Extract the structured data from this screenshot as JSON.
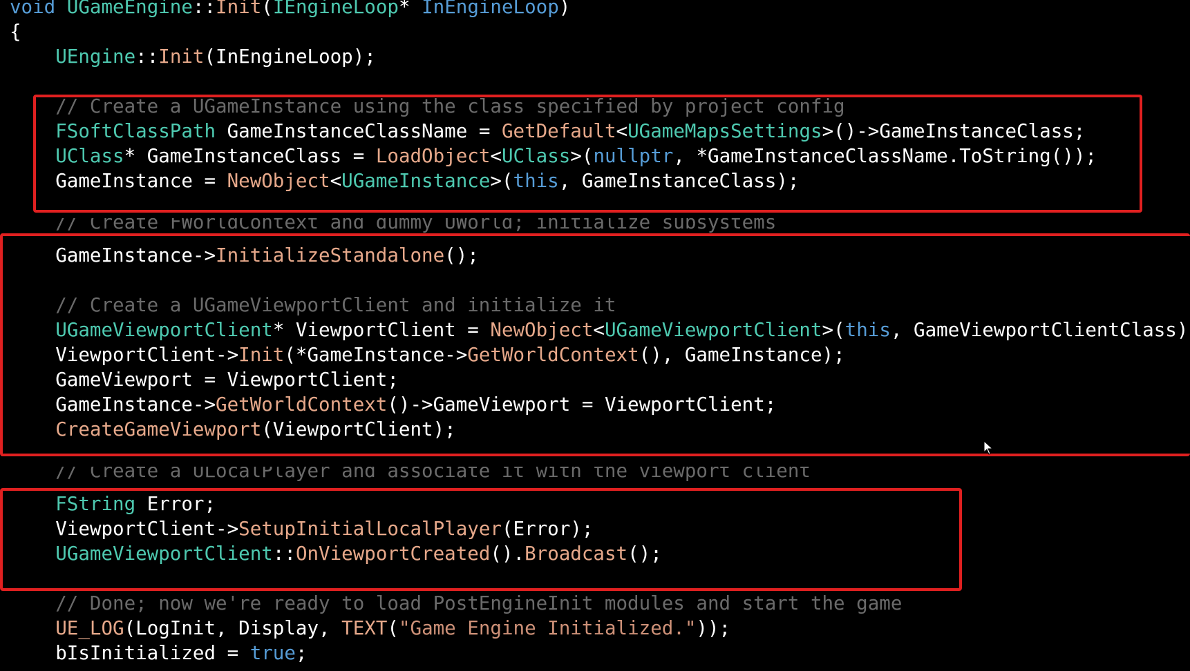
{
  "theme": {
    "background": "#000000",
    "highlight_border": "#e02020",
    "token_colors": {
      "keyword": "#569cd6",
      "type": "#4ec9b0",
      "func": "#e6a88a",
      "comment": "#6a6a6a",
      "string": "#ce9178",
      "plain": "#ffffff"
    }
  },
  "code": {
    "lines": [
      [
        [
          "keyword",
          "void "
        ],
        [
          "type",
          "UGameEngine"
        ],
        [
          "plain",
          "::"
        ],
        [
          "func",
          "Init"
        ],
        [
          "plain",
          "("
        ],
        [
          "type",
          "IEngineLoop"
        ],
        [
          "plain",
          "* "
        ],
        [
          "keyword",
          "InEngineLoop"
        ],
        [
          "plain",
          ")"
        ]
      ],
      [
        [
          "plain",
          "{"
        ]
      ],
      [
        [
          "plain",
          "    "
        ],
        [
          "type",
          "UEngine"
        ],
        [
          "plain",
          "::"
        ],
        [
          "func",
          "Init"
        ],
        [
          "plain",
          "(InEngineLoop);"
        ]
      ],
      [],
      [
        [
          "comment",
          "    // Create a UGameInstance using the class specified by project config"
        ]
      ],
      [
        [
          "plain",
          "    "
        ],
        [
          "type",
          "FSoftClassPath"
        ],
        [
          "plain",
          " GameInstanceClassName = "
        ],
        [
          "func",
          "GetDefault"
        ],
        [
          "plain",
          "<"
        ],
        [
          "type",
          "UGameMapsSettings"
        ],
        [
          "plain",
          ">()->GameInstanceClass;"
        ]
      ],
      [
        [
          "plain",
          "    "
        ],
        [
          "type",
          "UClass"
        ],
        [
          "plain",
          "* GameInstanceClass = "
        ],
        [
          "func",
          "LoadObject"
        ],
        [
          "plain",
          "<"
        ],
        [
          "type",
          "UClass"
        ],
        [
          "plain",
          ">("
        ],
        [
          "keyword",
          "nullptr"
        ],
        [
          "plain",
          ", *GameInstanceClassName.ToString());"
        ]
      ],
      [
        [
          "plain",
          "    GameInstance = "
        ],
        [
          "func",
          "NewObject"
        ],
        [
          "plain",
          "<"
        ],
        [
          "type",
          "UGameInstance"
        ],
        [
          "plain",
          ">("
        ],
        [
          "keyword",
          "this"
        ],
        [
          "plain",
          ", GameInstanceClass);"
        ]
      ],
      [],
      [
        [
          "comment",
          "    // Create FWorldContext and dummy UWorld; initialize subsystems"
        ]
      ],
      [
        [
          "plain",
          "    GameInstance->"
        ],
        [
          "func",
          "InitializeStandalone"
        ],
        [
          "plain",
          "();"
        ]
      ],
      [],
      [
        [
          "comment",
          "    // Create a UGameViewportClient and initialize it"
        ]
      ],
      [
        [
          "plain",
          "    "
        ],
        [
          "type",
          "UGameViewportClient"
        ],
        [
          "plain",
          "* ViewportClient = "
        ],
        [
          "func",
          "NewObject"
        ],
        [
          "plain",
          "<"
        ],
        [
          "type",
          "UGameViewportClient"
        ],
        [
          "plain",
          ">("
        ],
        [
          "keyword",
          "this"
        ],
        [
          "plain",
          ", GameViewportClientClass);"
        ]
      ],
      [
        [
          "plain",
          "    ViewportClient->"
        ],
        [
          "func",
          "Init"
        ],
        [
          "plain",
          "(*GameInstance->"
        ],
        [
          "func",
          "GetWorldContext"
        ],
        [
          "plain",
          "(), GameInstance);"
        ]
      ],
      [
        [
          "plain",
          "    GameViewport = ViewportClient;"
        ]
      ],
      [
        [
          "plain",
          "    GameInstance->"
        ],
        [
          "func",
          "GetWorldContext"
        ],
        [
          "plain",
          "()->GameViewport = ViewportClient;"
        ]
      ],
      [
        [
          "plain",
          "    "
        ],
        [
          "func",
          "CreateGameViewport"
        ],
        [
          "plain",
          "(ViewportClient);"
        ]
      ],
      [],
      [
        [
          "comment",
          "    // Create a ULocalPlayer and associate it with the viewport client"
        ]
      ],
      [
        [
          "plain",
          "    "
        ],
        [
          "type",
          "FString"
        ],
        [
          "plain",
          " Error;"
        ]
      ],
      [
        [
          "plain",
          "    ViewportClient->"
        ],
        [
          "func",
          "SetupInitialLocalPlayer"
        ],
        [
          "plain",
          "(Error);"
        ]
      ],
      [
        [
          "plain",
          "    "
        ],
        [
          "type",
          "UGameViewportClient"
        ],
        [
          "plain",
          "::"
        ],
        [
          "func",
          "OnViewportCreated"
        ],
        [
          "plain",
          "()."
        ],
        [
          "func",
          "Broadcast"
        ],
        [
          "plain",
          "();"
        ]
      ],
      [],
      [
        [
          "comment",
          "    // Done; now we're ready to load PostEngineInit modules and start the game"
        ]
      ],
      [
        [
          "plain",
          "    "
        ],
        [
          "func",
          "UE_LOG"
        ],
        [
          "plain",
          "(LogInit, Display, "
        ],
        [
          "func",
          "TEXT"
        ],
        [
          "plain",
          "("
        ],
        [
          "string",
          "\"Game Engine Initialized.\""
        ],
        [
          "plain",
          "));"
        ]
      ],
      [
        [
          "plain",
          "    bIsInitialized = "
        ],
        [
          "keyword",
          "true"
        ],
        [
          "plain",
          ";"
        ]
      ]
    ]
  }
}
